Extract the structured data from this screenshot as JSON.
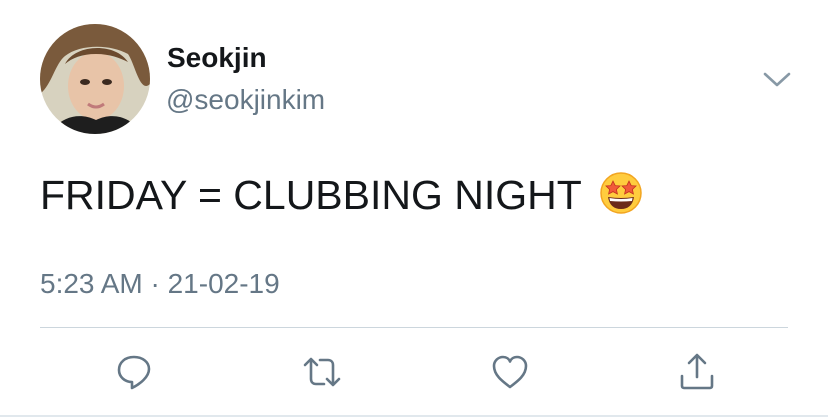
{
  "user": {
    "display_name": "Seokjin",
    "handle": "@seokjinkim"
  },
  "tweet": {
    "text": "FRIDAY = CLUBBING NIGHT",
    "emoji": "star-struck-emoji",
    "timestamp": "5:23 AM · 21-02-19"
  },
  "icons": {
    "menu": "chevron-down-icon",
    "reply": "reply-icon",
    "retweet": "retweet-icon",
    "like": "heart-icon",
    "share": "share-icon"
  },
  "colors": {
    "primary_text": "#14171a",
    "secondary_text": "#657786",
    "divider": "#ccd6dd"
  }
}
